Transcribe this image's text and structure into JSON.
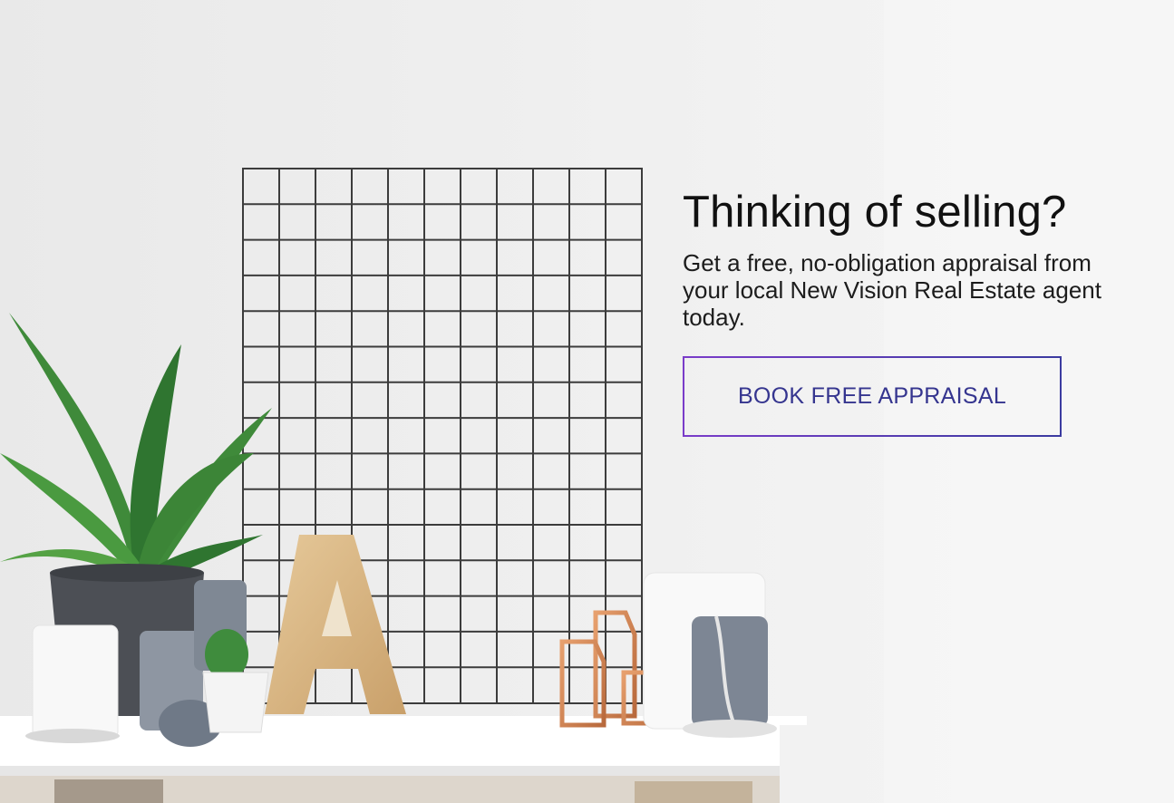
{
  "hero": {
    "headline": "Thinking of selling?",
    "subtext": "Get a free, no-obligation appraisal from your local New Vision Real Estate agent today.",
    "cta_label": "BOOK FREE APPRAISAL"
  },
  "colors": {
    "headline": "#111111",
    "cta_text": "#35358f",
    "cta_border_start": "#7a3cc9",
    "cta_border_end": "#3b3ba0",
    "wall": "#f3f3f3"
  },
  "photo": {
    "letter": "A"
  }
}
